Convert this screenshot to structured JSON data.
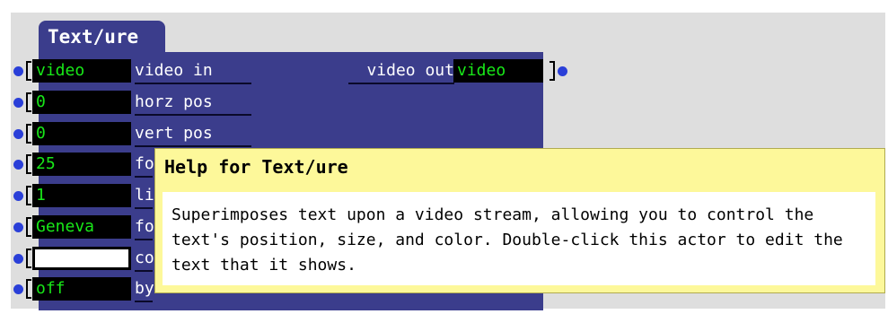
{
  "actor": {
    "title": "Text/ure",
    "inputs": [
      {
        "value": "video",
        "label": "video in",
        "style": "green"
      },
      {
        "value": "0",
        "label": "horz pos",
        "style": "green"
      },
      {
        "value": "0",
        "label": "vert pos",
        "style": "green"
      },
      {
        "value": "25",
        "label": "fo",
        "style": "green"
      },
      {
        "value": "1",
        "label": "lin",
        "style": "green"
      },
      {
        "value": "Geneva",
        "label": "fo",
        "style": "green"
      },
      {
        "value": "",
        "label": "co",
        "style": "white"
      },
      {
        "value": "off",
        "label": "by",
        "style": "green"
      }
    ],
    "output": {
      "label": "video out",
      "value": "video"
    }
  },
  "help": {
    "title": "Help for Text/ure",
    "text": "Superimposes text upon a video stream, allowing you to control the text's position, size, and color. Double-click this actor to edit the text that it shows."
  },
  "colors": {
    "actor_bg": "#3b3d8c",
    "value_text": "#18e818",
    "dot": "#2a3fd8",
    "help_bg": "#fdf89a"
  }
}
